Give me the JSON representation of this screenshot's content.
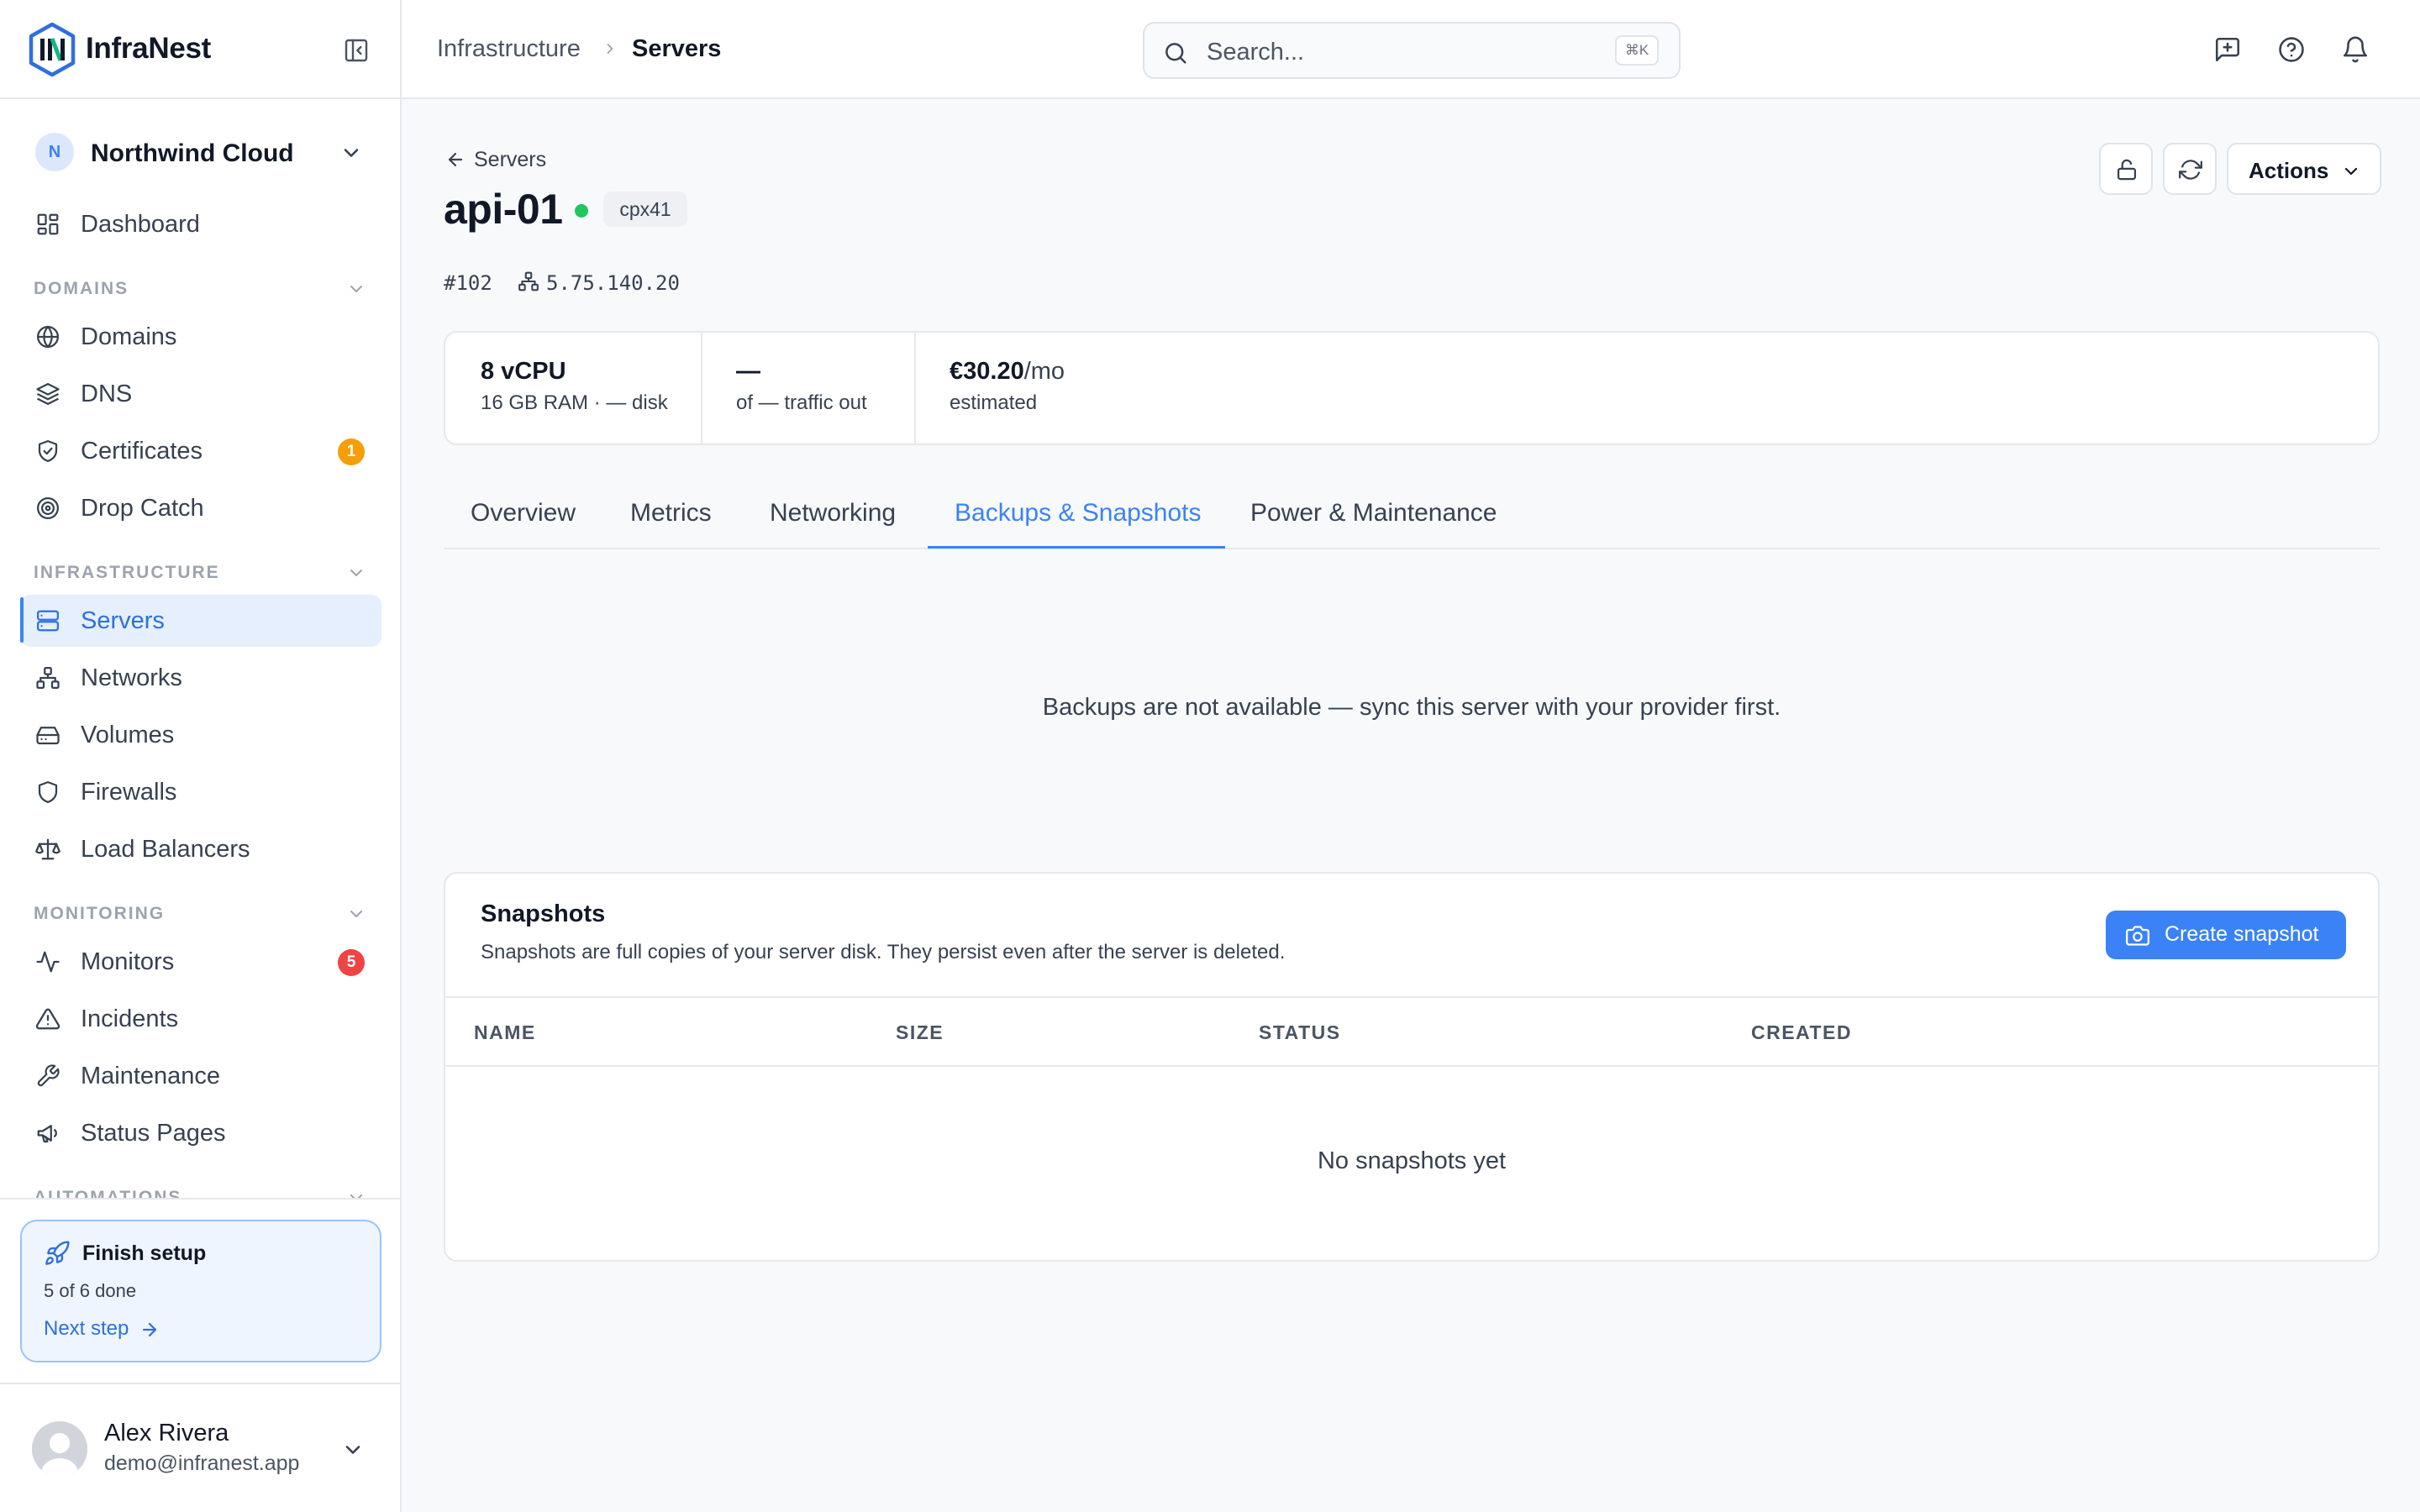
{
  "app": {
    "name": "InfraNest",
    "brand_color": "#3b82f6"
  },
  "workspace": {
    "initial": "N",
    "name": "Northwind Cloud"
  },
  "sidebar": {
    "dashboard": {
      "label": "Dashboard",
      "icon": "dashboard-icon"
    },
    "sections": [
      {
        "title": "DOMAINS",
        "items": [
          {
            "label": "Domains",
            "icon": "globe-icon"
          },
          {
            "label": "DNS",
            "icon": "layers-icon"
          },
          {
            "label": "Certificates",
            "icon": "shield-check-icon",
            "badge": "1",
            "badge_color": "#f59e0b"
          },
          {
            "label": "Drop Catch",
            "icon": "target-icon"
          }
        ]
      },
      {
        "title": "INFRASTRUCTURE",
        "items": [
          {
            "label": "Servers",
            "icon": "server-icon",
            "active": true
          },
          {
            "label": "Networks",
            "icon": "network-icon"
          },
          {
            "label": "Volumes",
            "icon": "hard-drive-icon"
          },
          {
            "label": "Firewalls",
            "icon": "shield-icon"
          },
          {
            "label": "Load Balancers",
            "icon": "scale-icon"
          }
        ]
      },
      {
        "title": "MONITORING",
        "items": [
          {
            "label": "Monitors",
            "icon": "activity-icon",
            "badge": "5",
            "badge_color": "#ef4444"
          },
          {
            "label": "Incidents",
            "icon": "alert-triangle-icon"
          },
          {
            "label": "Maintenance",
            "icon": "wrench-icon"
          },
          {
            "label": "Status Pages",
            "icon": "megaphone-icon"
          }
        ]
      },
      {
        "title": "AUTOMATIONS",
        "items": []
      }
    ]
  },
  "setup": {
    "title": "Finish setup",
    "progress": "5 of 6 done",
    "link": "Next step",
    "done": 5,
    "total": 6
  },
  "user": {
    "name": "Alex Rivera",
    "email": "demo@infranest.app"
  },
  "header": {
    "breadcrumb": [
      "Infrastructure",
      "Servers"
    ],
    "search_placeholder": "Search...",
    "search_shortcut": "⌘K"
  },
  "server": {
    "back_label": "Servers",
    "name": "api-01",
    "status_color": "#22c55e",
    "type": "cpx41",
    "id": "#102",
    "ip": "5.75.140.20",
    "actions_label": "Actions"
  },
  "stats": [
    {
      "value": "8 vCPU",
      "unit": "",
      "sub": "16 GB RAM · — disk"
    },
    {
      "value": "—",
      "unit": "",
      "sub": "of — traffic out"
    },
    {
      "value": "€30.20",
      "unit": "/mo",
      "sub": "estimated"
    }
  ],
  "tabs": [
    "Overview",
    "Metrics",
    "Networking",
    "Backups & Snapshots",
    "Power & Maintenance"
  ],
  "active_tab": "Backups & Snapshots",
  "backups_message": "Backups are not available — sync this server with your provider first.",
  "snapshots": {
    "title": "Snapshots",
    "description": "Snapshots are full copies of your server disk. They persist even after the server is deleted.",
    "create_label": "Create snapshot",
    "columns": [
      "NAME",
      "SIZE",
      "STATUS",
      "CREATED"
    ],
    "empty": "No snapshots yet"
  }
}
